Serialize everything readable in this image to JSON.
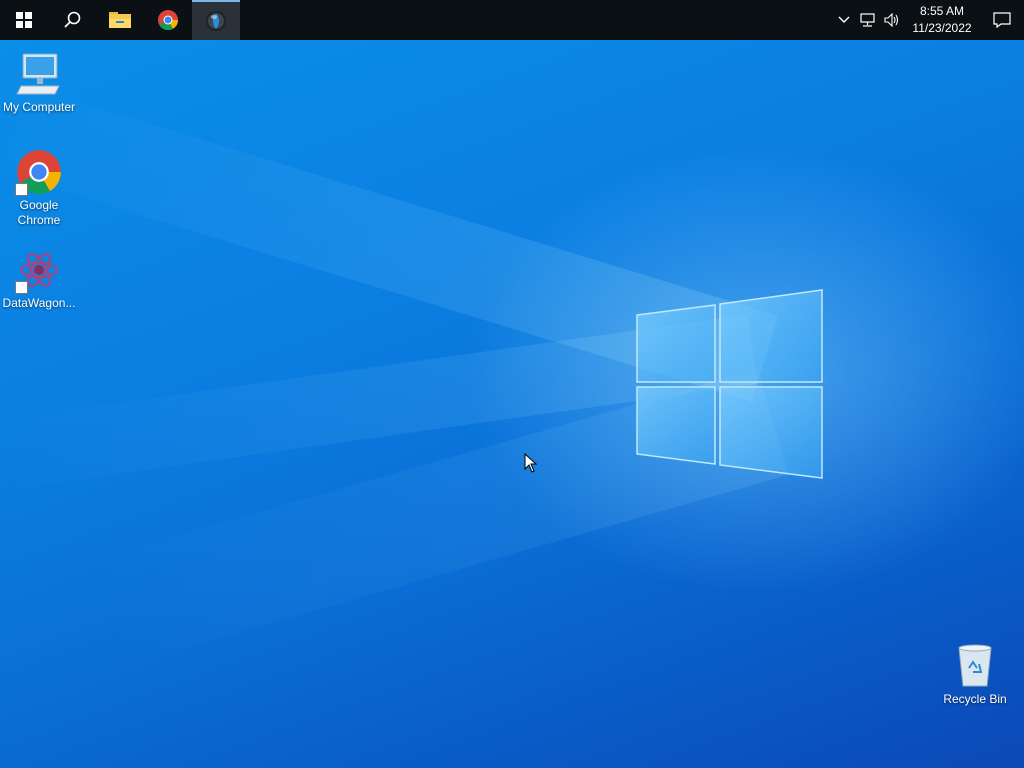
{
  "taskbar": {
    "start_icon": "windows-start-icon",
    "pinned": [
      {
        "name": "search",
        "icon": "search-icon"
      },
      {
        "name": "file-explorer",
        "icon": "folder-icon"
      },
      {
        "name": "chrome",
        "icon": "chrome-icon"
      },
      {
        "name": "app",
        "icon": "app-sphere-icon",
        "active": true
      }
    ],
    "tray": {
      "icons": [
        "chevron-up-icon",
        "network-icon",
        "volume-icon"
      ],
      "time": "8:55 AM",
      "date": "11/23/2022",
      "notification_icon": "action-center-icon"
    }
  },
  "desktop": {
    "icons": [
      {
        "label": "My Computer",
        "icon": "computer-icon"
      },
      {
        "label_line1": "Google",
        "label_line2": "Chrome",
        "icon": "chrome-icon",
        "shortcut": true
      },
      {
        "label": "DataWagon...",
        "icon": "datawagon-icon",
        "shortcut": true
      },
      {
        "label": "Recycle Bin",
        "icon": "recycle-bin-icon"
      }
    ]
  },
  "colors": {
    "taskbar": "#0b1014",
    "wallpaper_main": "#0a6fd8",
    "active_indicator": "#7eb4ea"
  }
}
